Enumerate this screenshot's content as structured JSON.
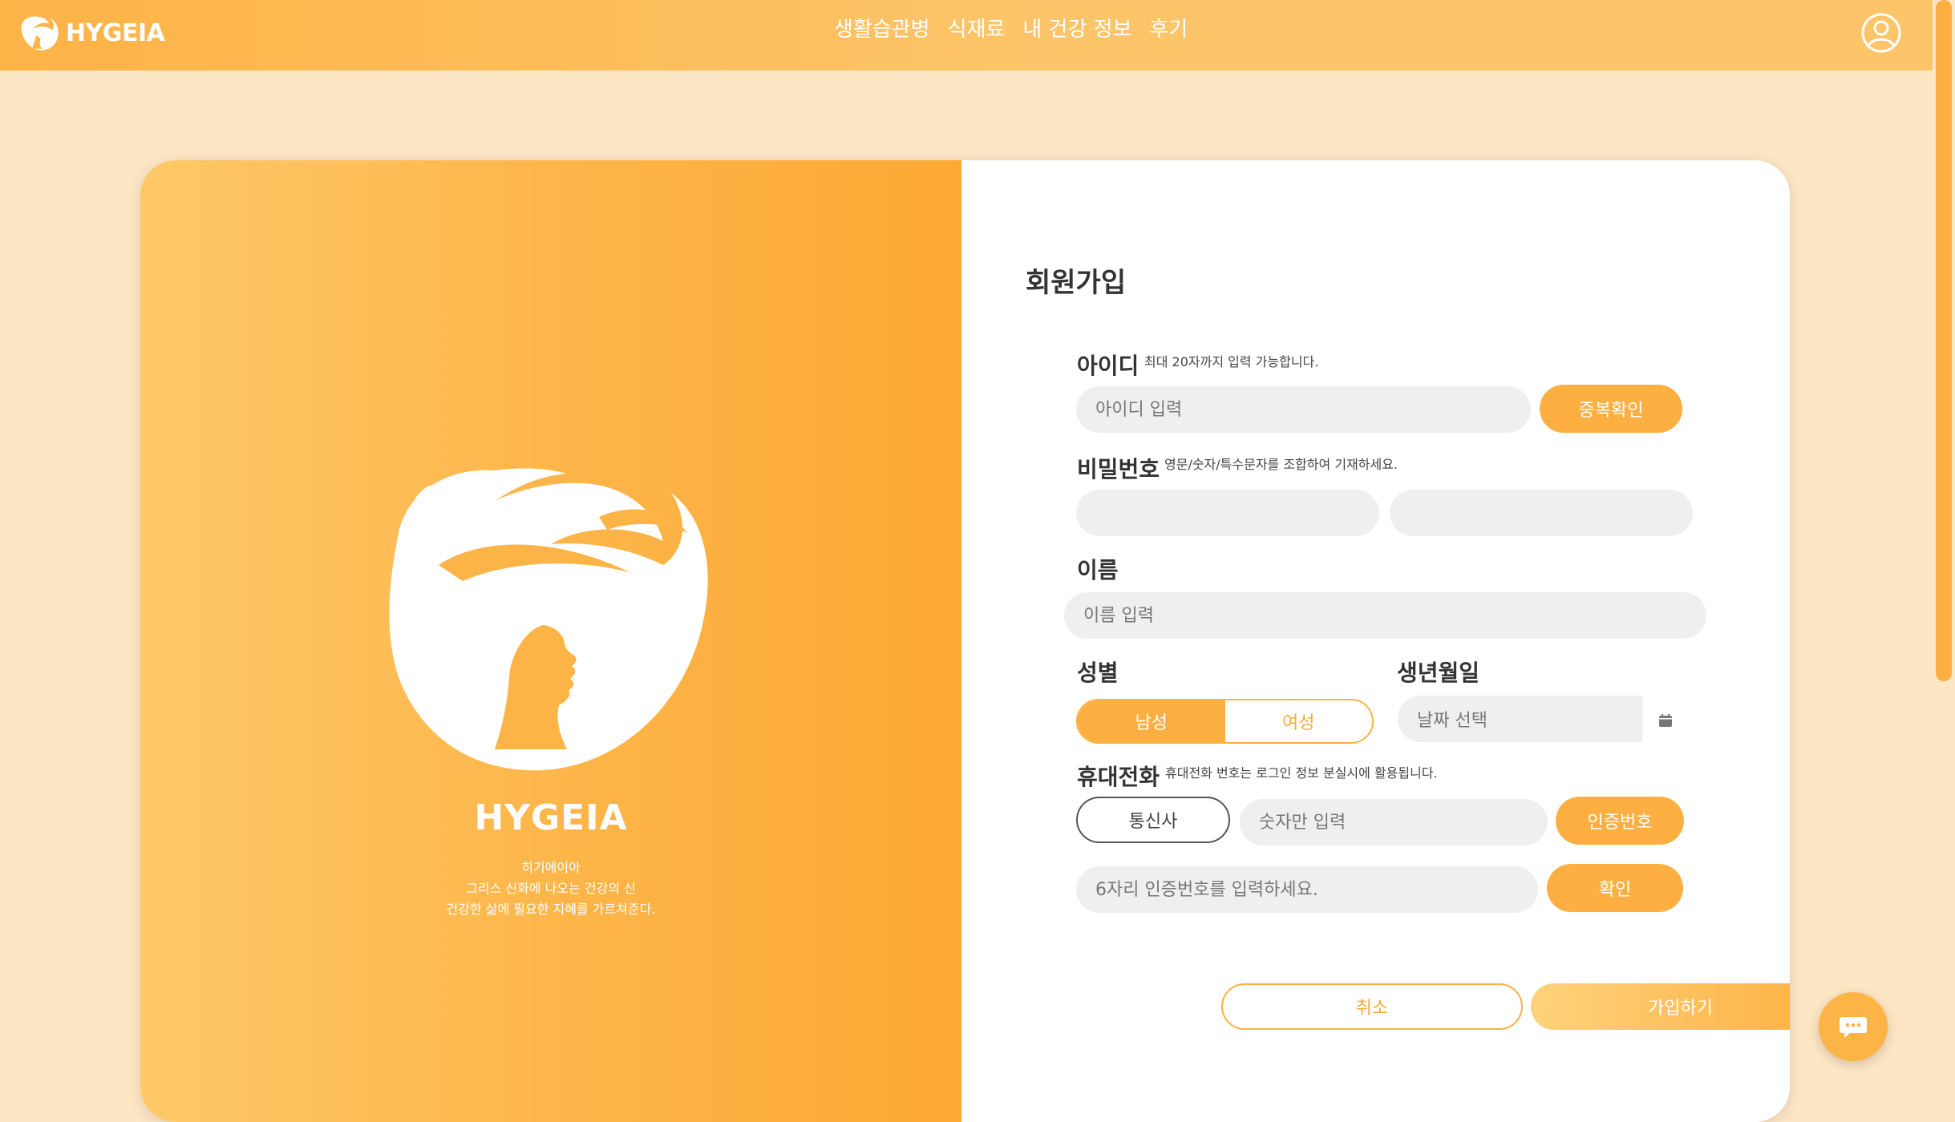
{
  "header": {
    "brand": "HYGEIA",
    "nav": [
      "생활습관병",
      "식재료",
      "내 건강 정보",
      "후기"
    ]
  },
  "hero": {
    "brand": "HYGEIA",
    "desc_lines": [
      "히기에이아",
      "그리스 신화에 나오는 건강의 신",
      "건강한 삶에 필요한 지혜를 가르쳐준다."
    ]
  },
  "form": {
    "title": "회원가입",
    "id": {
      "label": "아이디",
      "hint": "최대 20자까지 입력 가능합니다.",
      "placeholder": "아이디 입력",
      "check_button": "중복확인"
    },
    "password": {
      "label": "비밀번호",
      "hint": "영문/숫자/특수문자를 조합하여 기재하세요."
    },
    "name": {
      "label": "이름",
      "placeholder": "이름 입력"
    },
    "gender": {
      "label": "성별",
      "male": "남성",
      "female": "여성",
      "selected": "남성"
    },
    "birth": {
      "label": "생년월일",
      "placeholder": "날짜 선택"
    },
    "phone": {
      "label": "휴대전화",
      "hint": "휴대전화 번호는 로그인 정보 분실시에 활용됩니다.",
      "carrier": "통신사",
      "number_placeholder": "숫자만 입력",
      "code_button": "인증번호",
      "code_placeholder": "6자리 인증번호를 입력하세요.",
      "confirm_button": "확인"
    },
    "cancel_button": "취소",
    "submit_button": "가입하기"
  },
  "colors": {
    "accent": "#fdb041",
    "background": "#fde6c4",
    "field": "#efefef"
  }
}
